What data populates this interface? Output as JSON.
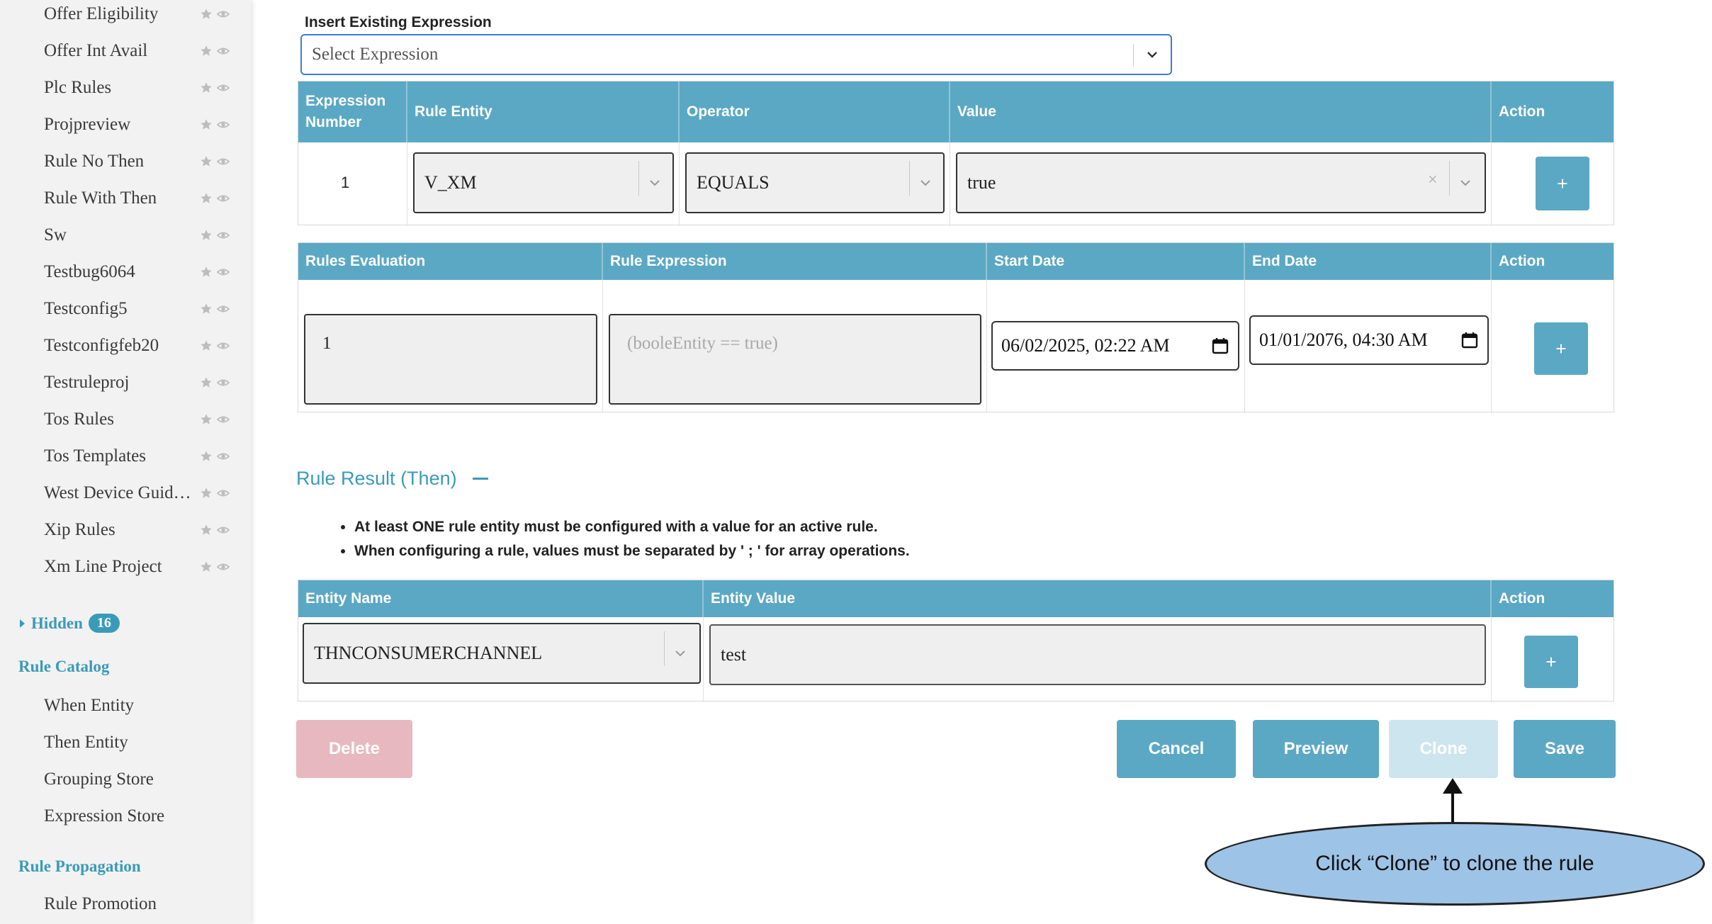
{
  "sidebar": {
    "items": [
      {
        "label": "Offer Eligibility"
      },
      {
        "label": "Offer Int Avail"
      },
      {
        "label": "Plc Rules"
      },
      {
        "label": "Projpreview"
      },
      {
        "label": "Rule No Then"
      },
      {
        "label": "Rule With Then"
      },
      {
        "label": "Sw"
      },
      {
        "label": "Testbug6064"
      },
      {
        "label": "Testconfig5"
      },
      {
        "label": "Testconfigfeb20"
      },
      {
        "label": "Testruleproj"
      },
      {
        "label": "Tos Rules"
      },
      {
        "label": "Tos Templates"
      },
      {
        "label": "West Device Guide Rules"
      },
      {
        "label": "Xip Rules"
      },
      {
        "label": "Xm Line Project"
      }
    ],
    "hidden": {
      "label": "Hidden",
      "count": "16"
    },
    "rule_catalog": {
      "title": "Rule Catalog",
      "items": [
        "When Entity",
        "Then Entity",
        "Grouping Store",
        "Expression Store"
      ]
    },
    "rule_propagation": {
      "title": "Rule Propagation",
      "items": [
        "Rule Promotion"
      ]
    }
  },
  "expression": {
    "label": "Insert Existing Expression",
    "placeholder": "Select Expression"
  },
  "expr_table": {
    "headers": [
      "Expression Number",
      "Rule Entity",
      "Operator",
      "Value",
      "Action"
    ],
    "row": {
      "number": "1",
      "entity": "V_XM",
      "operator": "EQUALS",
      "value": "true",
      "action": "+"
    }
  },
  "eval_table": {
    "headers": [
      "Rules Evaluation",
      "Rule Expression",
      "Start Date",
      "End Date",
      "Action"
    ],
    "row": {
      "evaluation": "1",
      "expression_placeholder": "(booleEntity == true)",
      "start_date": "06/02/2025, 02:22  AM",
      "end_date": "01/01/2076, 04:30  AM",
      "action": "+"
    }
  },
  "result": {
    "title": "Rule Result (Then)",
    "notes": [
      "At least ONE rule entity must be configured with a value for an active rule.",
      "When configuring a rule, values must be separated by ' ; ' for array operations."
    ]
  },
  "entity_table": {
    "headers": [
      "Entity Name",
      "Entity Value",
      "Action"
    ],
    "row": {
      "name": "THNCONSUMERCHANNEL",
      "value": "test",
      "action": "+"
    }
  },
  "buttons": {
    "delete": "Delete",
    "cancel": "Cancel",
    "preview": "Preview",
    "clone": "Clone",
    "save": "Save"
  },
  "colors": {
    "accent": "#5ba8c4",
    "link": "#3a9bb8",
    "delete_disabled": "#e8b8c0",
    "clone_disabled": "#cce5ee",
    "callout": "#9dc3e6"
  },
  "annotation": {
    "text": "Click “Clone” to clone the rule"
  }
}
